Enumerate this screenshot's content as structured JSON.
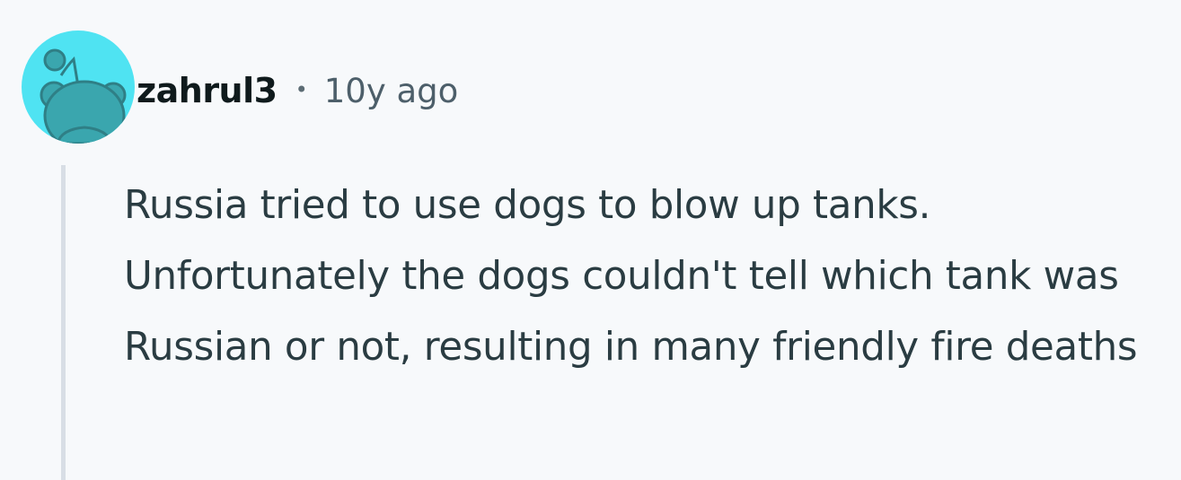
{
  "comment": {
    "username": "zahrul3",
    "separator": "•",
    "time_ago": "10y ago",
    "body": "Russia tried to use dogs to blow up tanks. Unfortunately the dogs couldn't tell which tank was Russian or not, resulting in many friendly fire deaths",
    "avatar": {
      "icon": "snoo-avatar-icon",
      "background_color": "#4fe3f2",
      "figure_color": "#3aa6ae"
    }
  }
}
